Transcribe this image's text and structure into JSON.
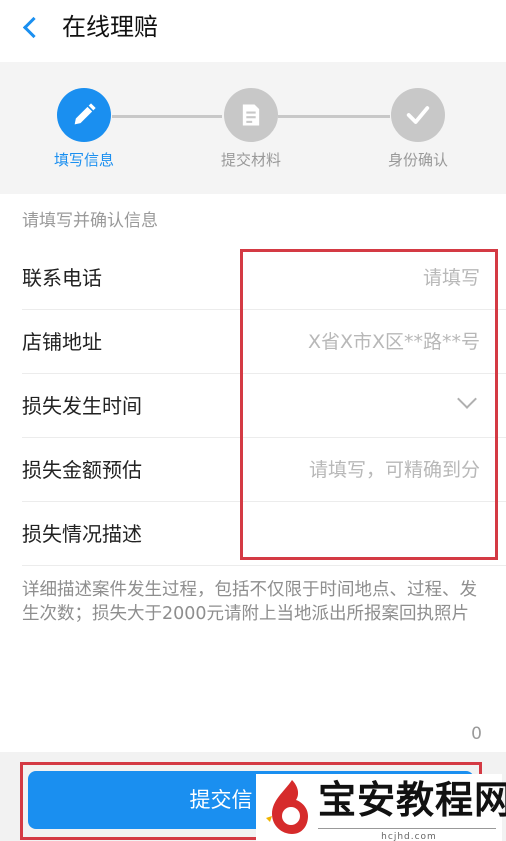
{
  "header": {
    "title": "在线理赔"
  },
  "steps": [
    {
      "label": "填写信息",
      "icon": "pencil-icon",
      "active": true
    },
    {
      "label": "提交材料",
      "icon": "document-icon",
      "active": false
    },
    {
      "label": "身份确认",
      "icon": "checkmark-icon",
      "active": false
    }
  ],
  "colors": {
    "accent": "#1a8ff0",
    "inactive_step": "#c8c8c8",
    "highlight": "#d43a44"
  },
  "form": {
    "section_hint": "请填写并确认信息",
    "fields": [
      {
        "label": "联系电话",
        "placeholder": "请填写"
      },
      {
        "label": "店铺地址",
        "placeholder": "X省X市X区**路**号"
      },
      {
        "label": "损失发生时间",
        "placeholder": ""
      },
      {
        "label": "损失金额预估",
        "placeholder": "请填写，可精确到分"
      },
      {
        "label": "损失情况描述",
        "placeholder": ""
      }
    ],
    "description_placeholder": "详细描述案件发生过程，包括不仅限于时间地点、过程、发生次数；损失大于2000元请附上当地派出所报案回执照片",
    "char_count": "0"
  },
  "submit": {
    "label": "提交信"
  },
  "watermark": {
    "title": "宝安教程网",
    "domain": "hcjhd.com"
  }
}
